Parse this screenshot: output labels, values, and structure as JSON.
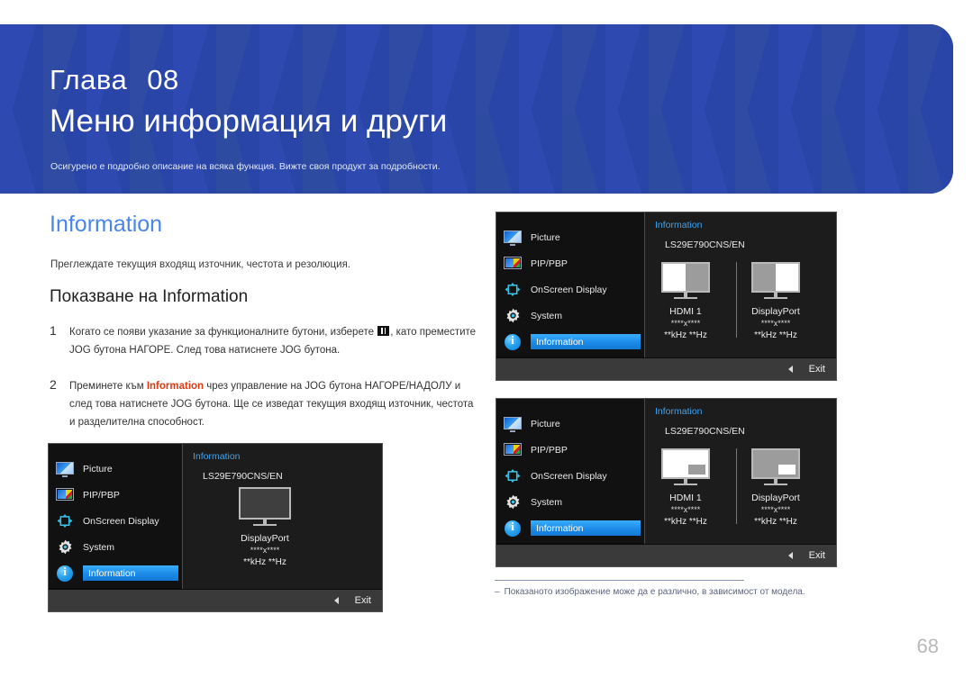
{
  "header": {
    "chapter_label": "Глава",
    "chapter_number": "08",
    "title": "Меню информация и други",
    "subtitle": "Осигурено е подробно описание на всяка функция. Вижте своя продукт за подробности.",
    "bg_color": "#2a45a8"
  },
  "main": {
    "section_title": "Information",
    "section_title_color": "#4a86e8",
    "description": "Преглеждате текущия входящ източник, честота и резолюция.",
    "subsection_title": "Показване на Information",
    "steps": [
      {
        "number": "1",
        "text_before_icon": "Когато се появи указание за функционалните бутони, изберете ",
        "icon": "menu-glyph-icon",
        "text_after_icon": ", като преместите JOG бутона НАГОРЕ. След това натиснете JOG бутона."
      },
      {
        "number": "2",
        "text_before_highlight": "Преминете към ",
        "highlight": "Information",
        "highlight_color": "#e03a10",
        "text_after_highlight": " чрез управление на JOG бутона НАГОРЕ/НАДОЛУ и след това натиснете JOG бутона. Ще се изведат текущия входящ източник, честота и разделителна способност."
      }
    ]
  },
  "osd": {
    "menu_items": [
      {
        "label": "Picture",
        "icon": "picture-icon",
        "selected": false
      },
      {
        "label": "PIP/PBP",
        "icon": "pip-pbp-icon",
        "selected": false
      },
      {
        "label": "OnScreen Display",
        "icon": "onscreen-display-icon",
        "selected": false
      },
      {
        "label": "System",
        "icon": "gear-icon",
        "selected": false
      },
      {
        "label": "Information",
        "icon": "information-icon",
        "selected": true
      }
    ],
    "panel_title": "Information",
    "panel_title_color": "#3fa3ef",
    "model": "LS29E790CNS/EN",
    "exit_label": "Exit",
    "exit_arrow_icon": "left-triangle-icon",
    "highlight_color": "#1b8ae8"
  },
  "osd_panels": {
    "single": {
      "mode": "single-source",
      "sources": [
        {
          "name": "DisplayPort",
          "resolution": "****x****",
          "frequency": "**kHz **Hz",
          "screen": "blank"
        }
      ]
    },
    "pbp": {
      "mode": "pbp-side-by-side",
      "sources": [
        {
          "name": "HDMI 1",
          "resolution": "****x****",
          "frequency": "**kHz **Hz",
          "screen": "left-white-right-gray"
        },
        {
          "name": "DisplayPort",
          "resolution": "****x****",
          "frequency": "**kHz **Hz",
          "screen": "left-gray-right-white"
        }
      ]
    },
    "pip": {
      "mode": "pip-inset",
      "sources": [
        {
          "name": "HDMI 1",
          "resolution": "****x****",
          "frequency": "**kHz **Hz",
          "screen": "white-with-gray-inset"
        },
        {
          "name": "DisplayPort",
          "resolution": "****x****",
          "frequency": "**kHz **Hz",
          "screen": "gray-with-white-inset"
        }
      ]
    }
  },
  "footnote": {
    "dash": "‒",
    "text": "Показаното изображение може да е различно, в зависимост от модела."
  },
  "page_number": "68"
}
